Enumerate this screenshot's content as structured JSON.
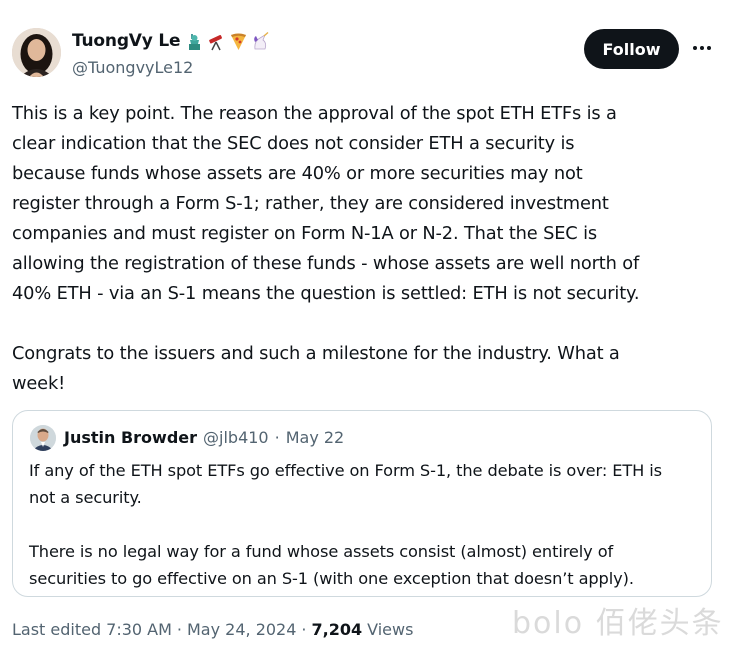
{
  "author": {
    "display_name": "TuongVy Le",
    "handle": "@TuongvyLe12",
    "emoji_icons": [
      "statue-of-liberty-icon",
      "telescope-icon",
      "pizza-icon",
      "unicorn-icon"
    ]
  },
  "actions": {
    "follow_label": "Follow",
    "more_icon": "more-dots-icon"
  },
  "tweet": {
    "lines": [
      "This is a key point. The reason the approval of the spot ETH ETFs is a",
      "clear indication that the SEC does not consider ETH a security is",
      "because funds whose assets are 40% or more securities may not",
      "register through a Form S-1; rather, they are considered investment",
      "companies and must register on Form N-1A or N-2. That the SEC is",
      "allowing the registration of these funds - whose assets are well north of",
      "40% ETH - via an S-1 means the question is settled: ETH is not security.",
      "",
      "Congrats to the issuers and such a milestone for the industry. What a",
      "week!"
    ]
  },
  "quoted": {
    "display_name": "Justin Browder",
    "handle": "@jlb410",
    "separator": "·",
    "date": "May 22",
    "lines": [
      "If any of the ETH spot ETFs go effective on Form S-1, the debate is over: ETH is",
      "not a security.",
      "",
      "There is no legal way for a fund whose assets consist (almost) entirely of",
      "securities to go effective on an S-1 (with one exception that doesn’t apply)."
    ]
  },
  "meta": {
    "edited_prefix": "Last edited",
    "time": "7:30 AM",
    "sep1": "·",
    "date": "May 24, 2024",
    "sep2": "·",
    "views_count": "7,204",
    "views_label": "Views"
  },
  "watermark": "bolo 佰佬头条"
}
